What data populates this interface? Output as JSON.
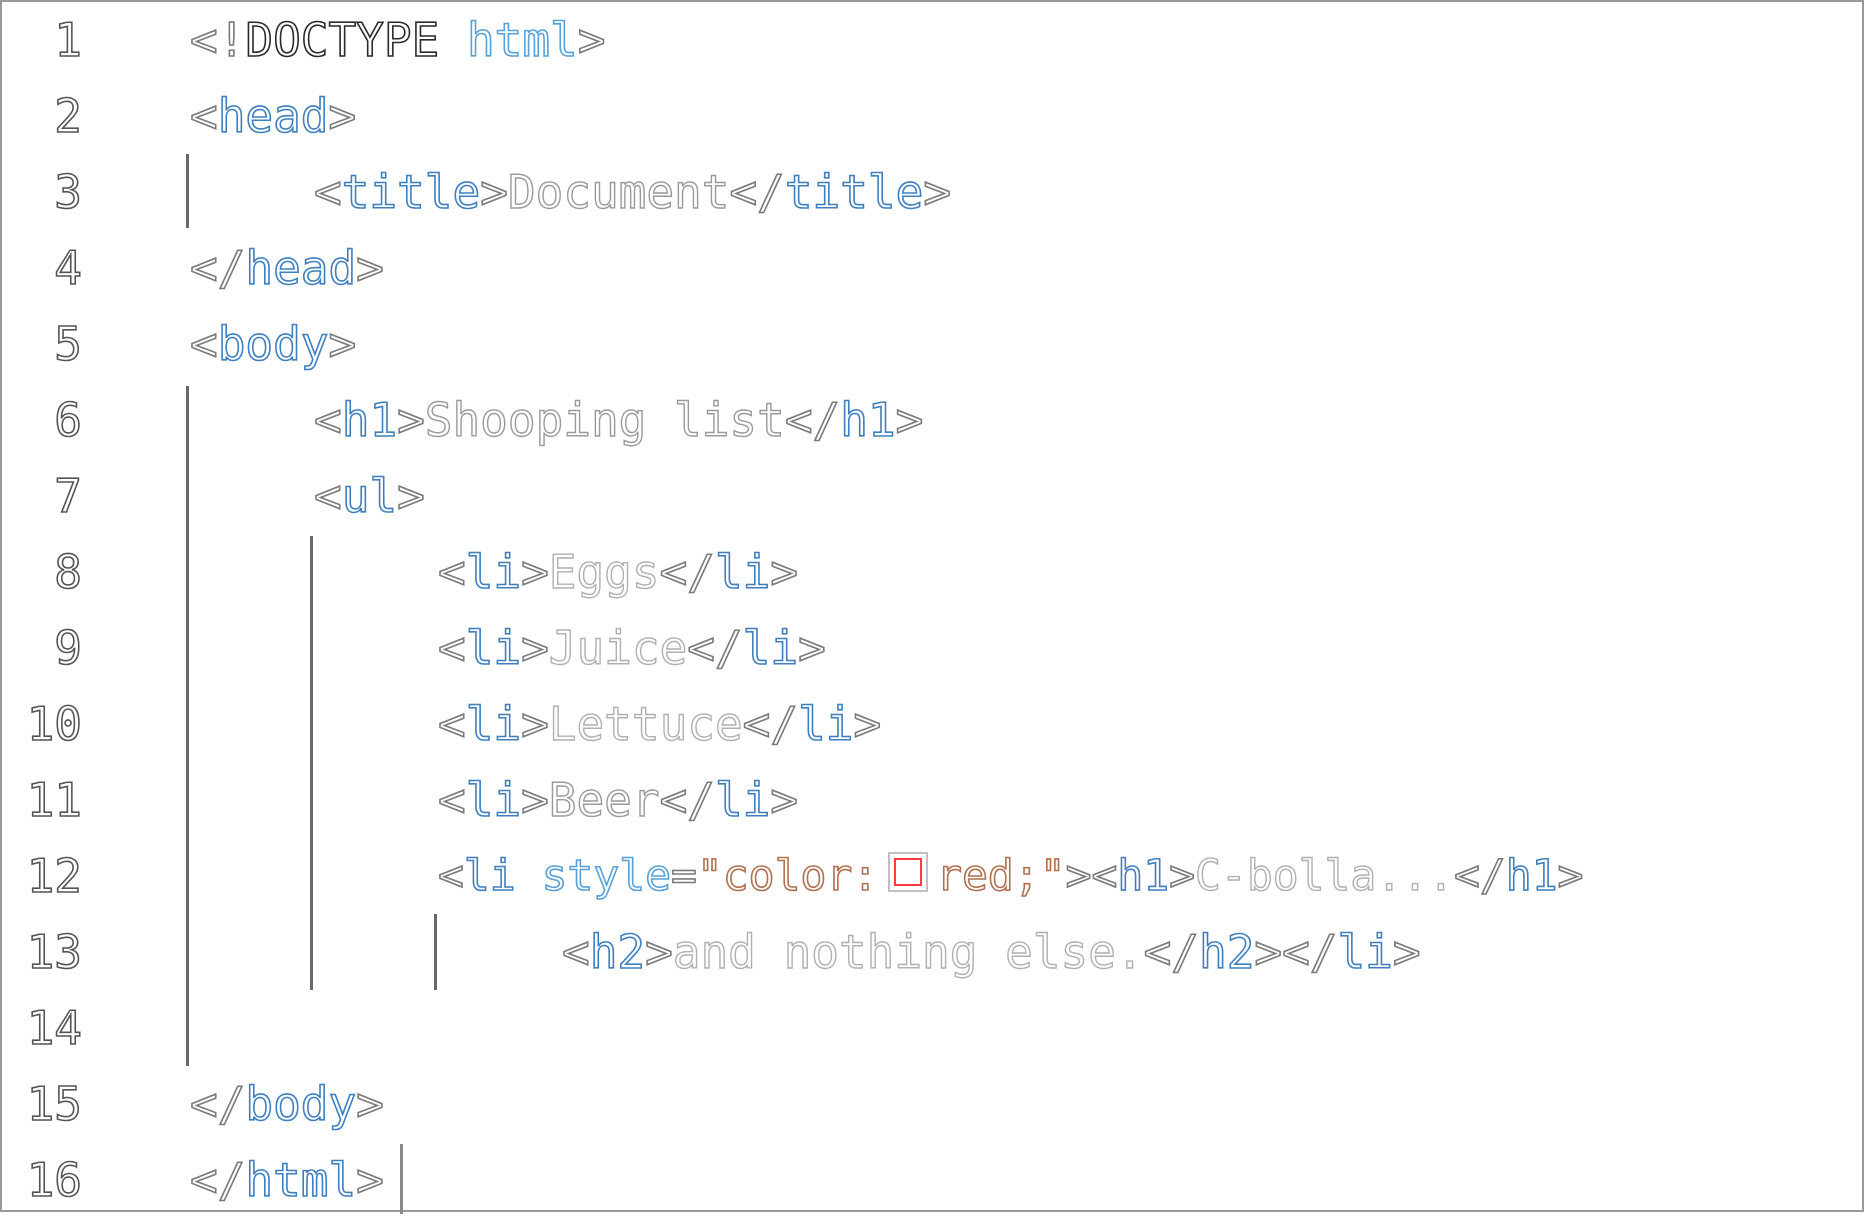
{
  "editor": {
    "line_numbers": [
      "1",
      "2",
      "3",
      "4",
      "5",
      "6",
      "7",
      "8",
      "9",
      "10",
      "11",
      "12",
      "13",
      "14",
      "15",
      "16"
    ],
    "lines": {
      "l1": {
        "doctype_open": "<!",
        "doctype": "DOCTYPE",
        "space": " ",
        "html": "html",
        "close": ">"
      },
      "l2": {
        "lt": "<",
        "tag": "head",
        "gt": ">"
      },
      "l3": {
        "lt": "<",
        "tag": "title",
        "gt": ">",
        "text": "Document",
        "lt2": "</",
        "tag2": "title",
        "gt2": ">"
      },
      "l4": {
        "lt": "</",
        "tag": "head",
        "gt": ">"
      },
      "l5": {
        "lt": "<",
        "tag": "body",
        "gt": ">"
      },
      "l6": {
        "lt": "<",
        "tag": "h1",
        "gt": ">",
        "text": "Shooping list",
        "lt2": "</",
        "tag2": "h1",
        "gt2": ">"
      },
      "l7": {
        "lt": "<",
        "tag": "ul",
        "gt": ">"
      },
      "l8": {
        "lt": "<",
        "tag": "li",
        "gt": ">",
        "text": "Eggs",
        "lt2": "</",
        "tag2": "li",
        "gt2": ">"
      },
      "l9": {
        "lt": "<",
        "tag": "li",
        "gt": ">",
        "text": "Juice",
        "lt2": "</",
        "tag2": "li",
        "gt2": ">"
      },
      "l10": {
        "lt": "<",
        "tag": "li",
        "gt": ">",
        "text": "Lettuce",
        "lt2": "</",
        "tag2": "li",
        "gt2": ">"
      },
      "l11": {
        "lt": "<",
        "tag": "li",
        "gt": ">",
        "text": "Beer",
        "lt2": "</",
        "tag2": "li",
        "gt2": ">"
      },
      "l12": {
        "lt": "<",
        "tag": "li",
        "space": " ",
        "attr": "style",
        "eq": "=",
        "q1": "\"",
        "prop": "color:",
        "value": "red;",
        "q2": "\"",
        "gt": ">",
        "lt_h1": "<",
        "tag_h1": "h1",
        "gt_h1": ">",
        "text": "C-bolla...",
        "lt2": "</",
        "tag2": "h1",
        "gt2": ">"
      },
      "l13": {
        "lt": "<",
        "tag": "h2",
        "gt": ">",
        "text": "and nothing else.",
        "lt2": "</",
        "tag2": "h2",
        "gt2": ">",
        "lt3": "</",
        "tag3": "li",
        "gt3": ">"
      },
      "l15": {
        "lt": "</",
        "tag": "body",
        "gt": ">"
      },
      "l16": {
        "lt": "</",
        "tag": "html",
        "gt": ">"
      }
    },
    "color_swatch": "#ff3b3b",
    "colors": {
      "tag": "#3f7fbf",
      "punctuation": "#7a7a7a",
      "text": "#9a9a9a",
      "attribute": "#5aa0d8",
      "string": "#b07050",
      "doctype": "#2a2a2a"
    }
  }
}
